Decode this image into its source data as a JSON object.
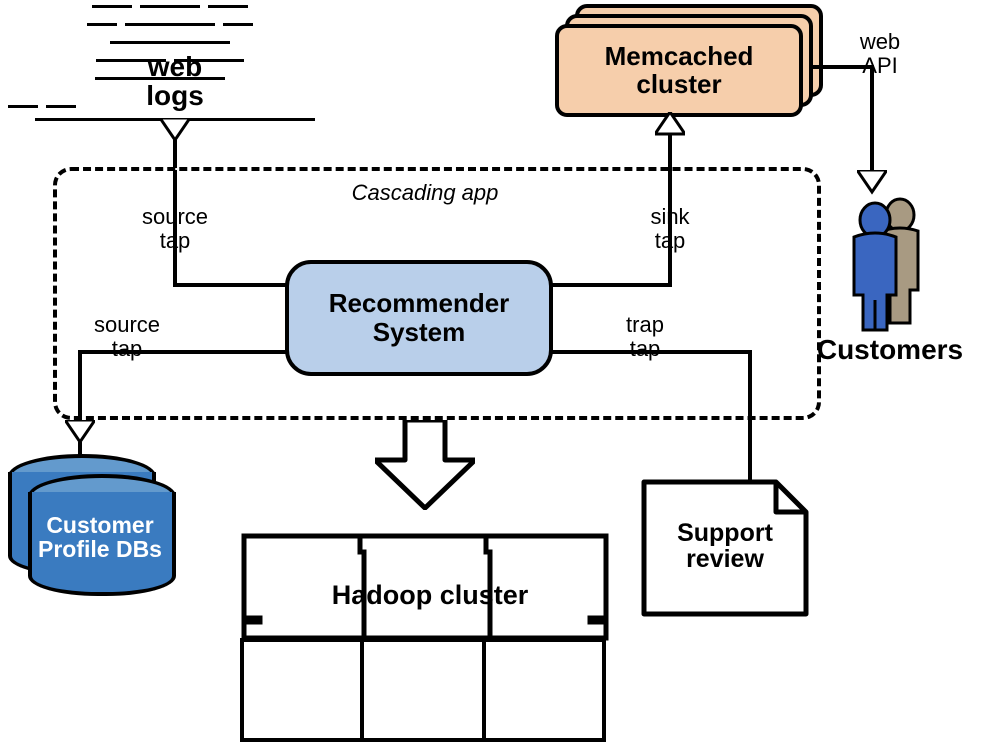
{
  "webLogs": {
    "label1": "web",
    "label2": "logs"
  },
  "memcached": {
    "label1": "Memcached",
    "label2": "cluster"
  },
  "webApi": {
    "label1": "web",
    "label2": "API"
  },
  "customers": {
    "label": "Customers"
  },
  "cascading": {
    "title": "Cascading app"
  },
  "taps": {
    "sourceTap1a": "source",
    "sourceTap1b": "tap",
    "sinkTapA": "sink",
    "sinkTapB": "tap",
    "sourceTap2a": "source",
    "sourceTap2b": "tap",
    "trapTapA": "trap",
    "trapTapB": "tap"
  },
  "recommender": {
    "label1": "Recommender",
    "label2": "System"
  },
  "hadoop": {
    "label": "Hadoop cluster"
  },
  "support": {
    "label1": "Support",
    "label2": "review"
  },
  "dbs": {
    "label1": "Customer",
    "label2": "Profile DBs"
  }
}
